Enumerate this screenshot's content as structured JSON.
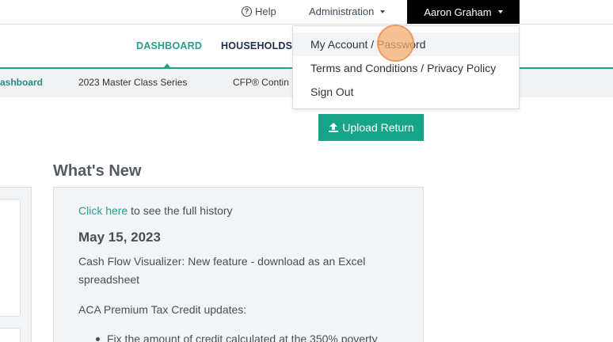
{
  "topbar": {
    "help_label": "Help",
    "help_icon": "question-circle-icon",
    "admin_label": "Administration",
    "user_label": "Aaron Graham"
  },
  "mainnav": {
    "items": [
      {
        "label": "DASHBOARD",
        "active": true
      },
      {
        "label": "HOUSEHOLDS",
        "active": false
      }
    ]
  },
  "subnav": {
    "items": [
      {
        "label": "ashboard",
        "active": true
      },
      {
        "label": "2023 Master Class Series",
        "active": false
      },
      {
        "label": "CFP® Contin",
        "active": false
      }
    ]
  },
  "upload": {
    "label": "Upload Return",
    "icon": "upload-icon"
  },
  "whats_new": {
    "heading": "What's New",
    "link_text": "Click here",
    "link_suffix": " to see the full history",
    "date": "May 15, 2023",
    "line1": "Cash Flow Visualizer: New feature - download as an Excel",
    "line2": "spreadsheet",
    "line3": "ACA Premium Tax Credit updates:",
    "bullet1": "Fix the amount of credit calculated at the 350% poverty"
  },
  "dropdown": {
    "items": [
      {
        "label": "My Account / Password",
        "hover": true
      },
      {
        "label": "Terms and Conditions / Privacy Policy",
        "hover": false
      },
      {
        "label": "Sign Out",
        "hover": false
      }
    ]
  },
  "colors": {
    "accent": "#2a9d8f",
    "button": "#17a589",
    "user_bg": "#000000",
    "navy": "#1f2f4a"
  }
}
